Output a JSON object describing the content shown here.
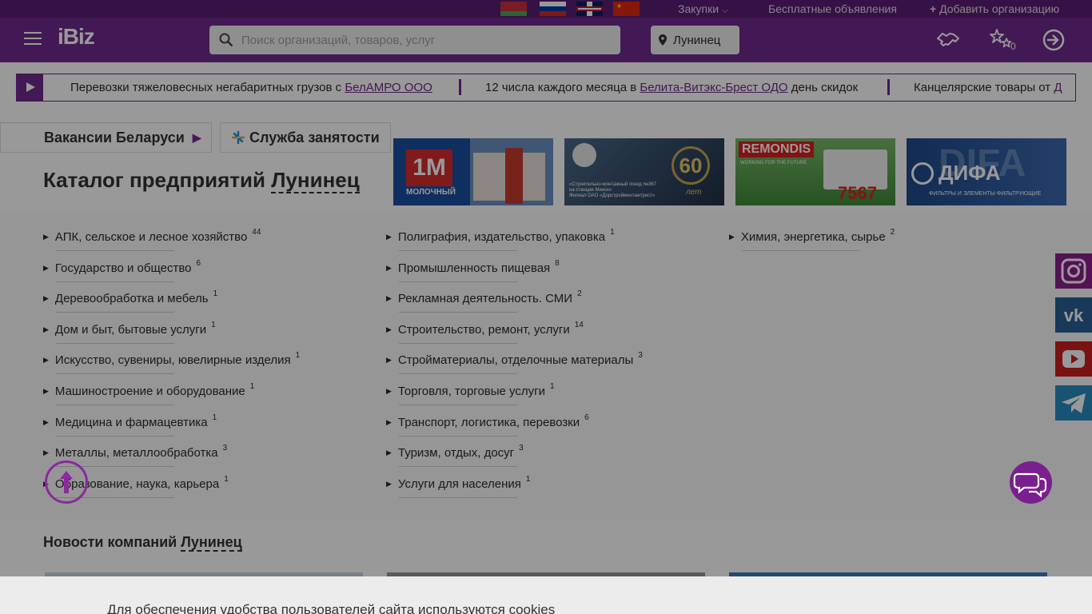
{
  "topbar": {
    "flags": [
      "flag-by",
      "flag-ru",
      "flag-gb",
      "flag-cn"
    ],
    "purchases_label": "Закупки",
    "free_ads_label": "Бесплатные объявления",
    "add_org_label": "Добавить организацию"
  },
  "header": {
    "logo": "iBiz",
    "search_placeholder": "Поиск организаций, товаров, услуг",
    "city_label": "Лунинец",
    "favorites_count": "0",
    "icons": [
      "menu-icon",
      "handshake-icon",
      "stars-icon",
      "login-icon"
    ]
  },
  "ticker": {
    "items": [
      {
        "prefix": "Перевозки тяжеловесных негабаритных грузов с ",
        "link": "БелАМРО ООО",
        "suffix": ""
      },
      {
        "prefix": "12 числа каждого месяца в ",
        "link": "Белита-Витэкс-Брест ОДО",
        "suffix": " день скидок"
      },
      {
        "prefix": "Канцелярские товары от ",
        "link": "Д",
        "suffix": ""
      }
    ]
  },
  "tabs": {
    "vacancies": "Вакансии Беларуси",
    "employment": "Служба занятости"
  },
  "catalog": {
    "title": "Каталог предприятий",
    "city": "Лунинец",
    "columns": [
      [
        {
          "label": "АПК, сельское и лесное хозяйство",
          "count": "44"
        },
        {
          "label": "Государство и общество",
          "count": "6"
        },
        {
          "label": "Деревообработка и мебель",
          "count": "1"
        },
        {
          "label": "Дом и быт, бытовые услуги",
          "count": "1"
        },
        {
          "label": "Искусство, сувениры, ювелирные изделия",
          "count": "1"
        },
        {
          "label": "Машиностроение и оборудование",
          "count": "1"
        },
        {
          "label": "Медицина и фармацевтика",
          "count": "1"
        },
        {
          "label": "Металлы, металлообработка",
          "count": "3"
        },
        {
          "label": "Образование, наука, карьера",
          "count": "1"
        }
      ],
      [
        {
          "label": "Полиграфия, издательство, упаковка",
          "count": "1"
        },
        {
          "label": "Промышленность пищевая",
          "count": "8"
        },
        {
          "label": "Рекламная деятельность. СМИ",
          "count": "2"
        },
        {
          "label": "Строительство, ремонт, услуги",
          "count": "14"
        },
        {
          "label": "Стройматериалы, отделочные материалы",
          "count": "3"
        },
        {
          "label": "Торговля, торговые услуги",
          "count": "1"
        },
        {
          "label": "Транспорт, логистика, перевозки",
          "count": "6"
        },
        {
          "label": "Туризм, отдых, досуг",
          "count": "3"
        },
        {
          "label": "Услуги для населения",
          "count": "1"
        }
      ],
      [
        {
          "label": "Химия, энергетика, сырье",
          "count": "2"
        }
      ]
    ]
  },
  "banners": [
    {
      "logo_text": "1M",
      "caption": "МОЛОЧНЫЙ"
    },
    {
      "line1": "«Строительно-монтажный поезд №367",
      "line2": "на станции Минск»",
      "line3": "Филиал ОАО «Дорстроймонтажтрест»",
      "badge": "60",
      "badge_sub": "лет"
    },
    {
      "brand": "REMONDIS",
      "tagline": "WORKING FOR THE FUTURE",
      "number": "7567"
    },
    {
      "brand": "ДИФА",
      "tagline": "ФИЛЬТРЫ И ЭЛЕМЕНТЫ ФИЛЬТРУЮЩИЕ",
      "bg_text": "DIFA"
    }
  ],
  "social": [
    {
      "name": "instagram",
      "color": "#8a1e8a"
    },
    {
      "name": "vk",
      "color": "#2a5f96"
    },
    {
      "name": "youtube",
      "color": "#cc1f1f"
    },
    {
      "name": "telegram",
      "color": "#2a8bc1"
    }
  ],
  "news": {
    "title": "Новости компаний",
    "city": "Лунинец"
  },
  "cookie": {
    "text": "Для обеспечения удобства пользователей сайта используются cookies"
  },
  "colors": {
    "brand": "#6e2a8d",
    "topbar": "#5a1d74"
  }
}
